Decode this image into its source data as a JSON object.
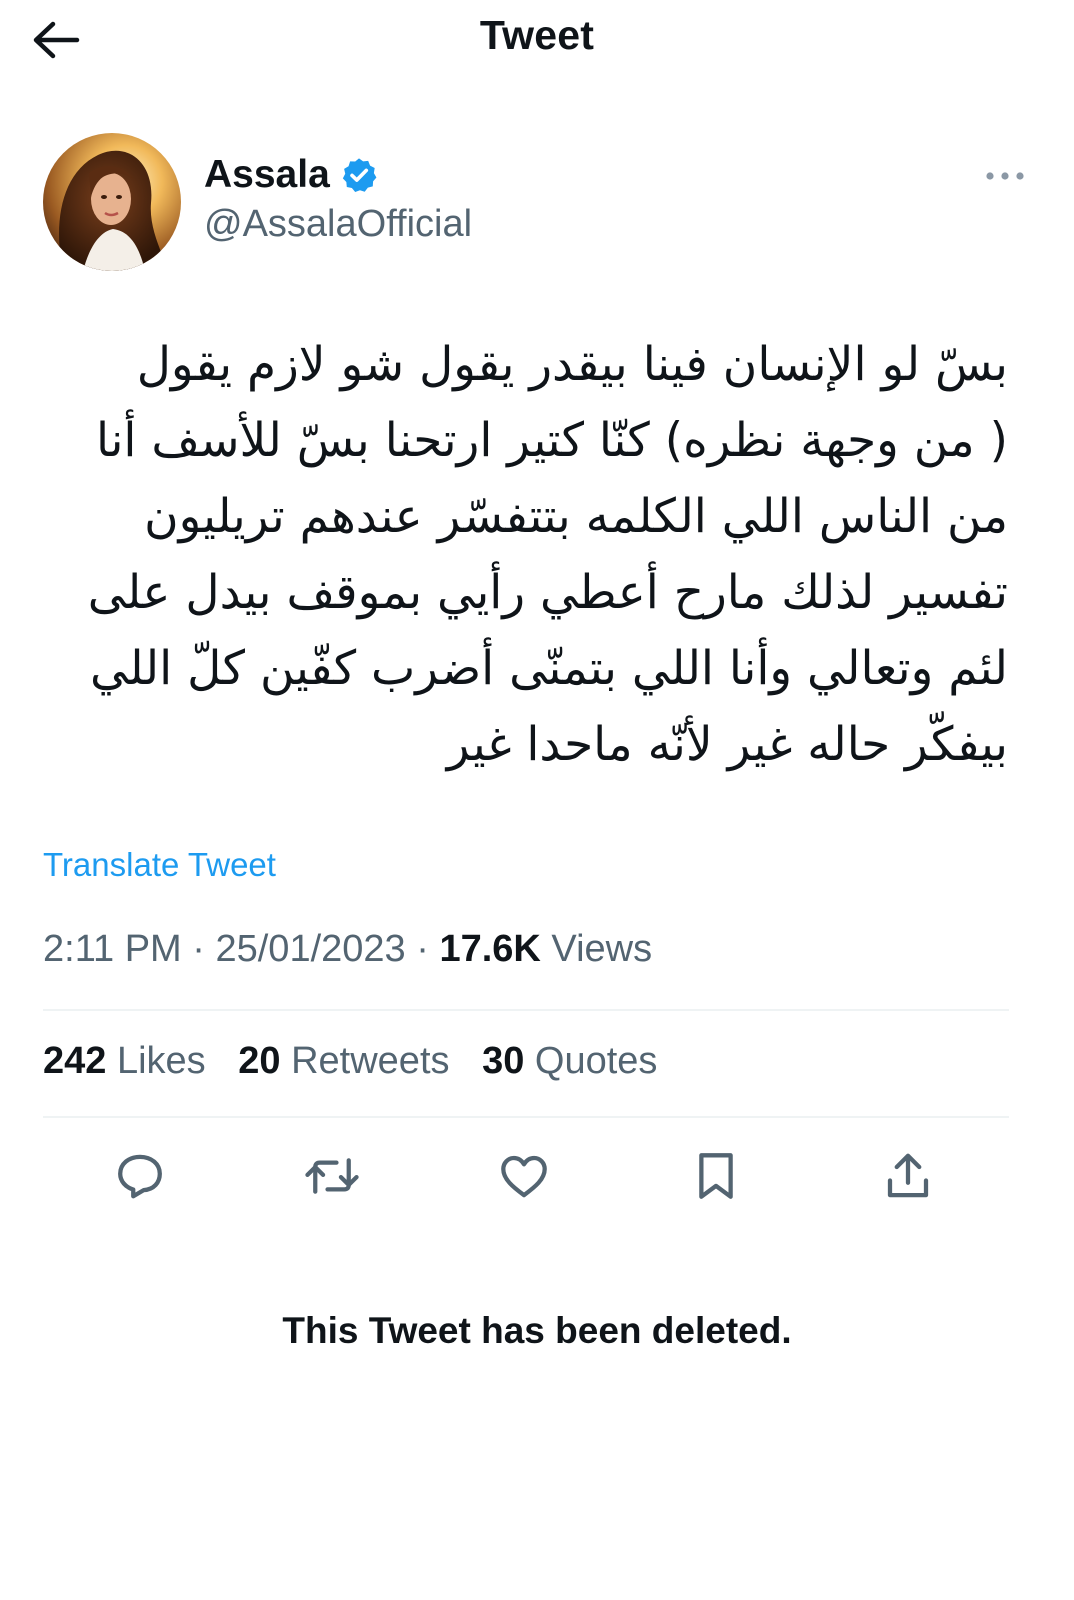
{
  "header": {
    "title": "Tweet",
    "back_icon": "arrow-left-icon"
  },
  "author": {
    "name": "Assala",
    "handle": "@AssalaOfficial",
    "verified": true,
    "more_icon": "more-horizontal-icon"
  },
  "tweet": {
    "lines": [
      "بسّ لو الإنسان فينا بيقدر يقول شو لازم يقول",
      "( من وجهة نظره) كنّا كتير ارتحنا بسّ للأسف أنا",
      "من الناس اللي الكلمه بتتفسّر عندهم تريليون",
      "تفسير لذلك مارح أعطي رأيي بموقف بيدل على",
      "لئم وتعالي وأنا اللي بتمنّى أضرب كفّين كلّ اللي",
      "بيفكّر حاله غير لأنّه ماحدا غير"
    ],
    "translate_label": "Translate Tweet",
    "time": "2:11 PM",
    "sep": "·",
    "date": "25/01/2023",
    "views_count": "17.6K",
    "views_label": "Views"
  },
  "stats": {
    "likes_count": "242",
    "likes_label": "Likes",
    "retweets_count": "20",
    "retweets_label": "Retweets",
    "quotes_count": "30",
    "quotes_label": "Quotes"
  },
  "actions": [
    "reply-icon",
    "retweet-icon",
    "like-icon",
    "bookmark-icon",
    "share-icon"
  ],
  "deleted_notice": "This Tweet has been deleted.",
  "colors": {
    "accent": "#1d9bf0",
    "text_primary": "#0f1419",
    "text_secondary": "#536471",
    "divider": "#eff3f4"
  }
}
